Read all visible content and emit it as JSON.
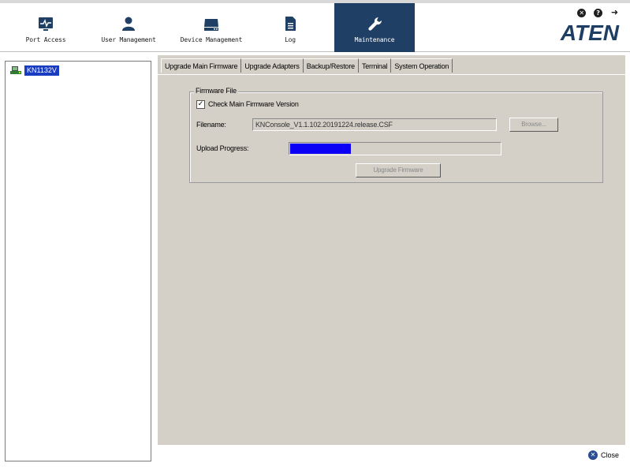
{
  "nav": {
    "port_access": "Port Access",
    "user_management": "User Management",
    "device_management": "Device Management",
    "log": "Log",
    "maintenance": "Maintenance",
    "active": "maintenance"
  },
  "header": {
    "logo": "ATEN",
    "icons": [
      "close-circle-icon",
      "help-icon",
      "logout-icon"
    ]
  },
  "sidebar": {
    "items": [
      {
        "label": "KN1132V",
        "icon": "kvm-device-icon",
        "selected": true
      }
    ]
  },
  "tabs": [
    {
      "label": "Upgrade Main Firmware",
      "active": true
    },
    {
      "label": "Upgrade Adapters",
      "active": false
    },
    {
      "label": "Backup/Restore",
      "active": false
    },
    {
      "label": "Terminal",
      "active": false
    },
    {
      "label": "System Operation",
      "active": false
    }
  ],
  "firmware": {
    "group_title": "Firmware File",
    "check_label": "Check Main Firmware Version",
    "check_checked": true,
    "check_mark": "✓",
    "filename_label": "Filename:",
    "filename_value": "KNConsole_V1.1.102.20191224.release.CSF",
    "browse_label": "Browse...",
    "progress_label": "Upload Progress:",
    "progress_fraction": 0.29,
    "upgrade_label": "Upgrade Firmware"
  },
  "footer": {
    "close_label": "Close"
  },
  "colors": {
    "nav_active": "#1f3f64",
    "logo": "#1e3e63",
    "selection": "#1a3cc0",
    "progress": "#0b00f5",
    "panel": "#d4d0c8"
  }
}
